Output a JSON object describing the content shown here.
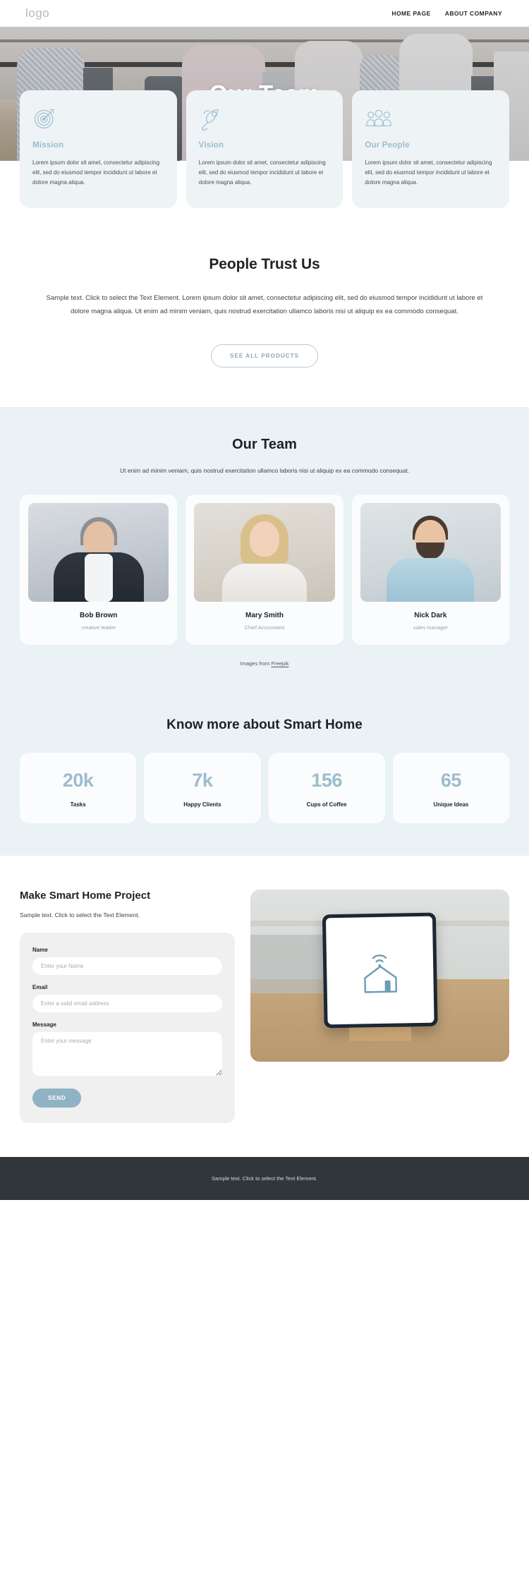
{
  "header": {
    "logo": "logo",
    "nav": [
      {
        "label": "HOME PAGE"
      },
      {
        "label": "ABOUT COMPANY"
      }
    ]
  },
  "hero": {
    "title": "Our Team"
  },
  "features": [
    {
      "icon": "target-icon",
      "title": "Mission",
      "text": "Lorem ipsum dolor sit amet, consectetur adipiscing elit, sed do eiusmod tempor incididunt ut labore et dolore magna aliqua."
    },
    {
      "icon": "rocket-icon",
      "title": "Vision",
      "text": "Lorem ipsum dolor sit amet, consectetur adipiscing elit, sed do eiusmod tempor incididunt ut labore et dolore magna aliqua."
    },
    {
      "icon": "people-group-icon",
      "title": "Our People",
      "text": "Lorem ipsum dolor sit amet, consectetur adipiscing elit, sed do eiusmod tempor incididunt ut labore et dolore magna aliqua."
    }
  ],
  "trust": {
    "title": "People Trust Us",
    "text": "Sample text. Click to select the Text Element. Lorem ipsum dolor sit amet, consectetur adipiscing elit, sed do eiusmod tempor incididunt ut labore et dolore magna aliqua. Ut enim ad minim veniam, quis nostrud exercitation ullamco laboris nisi ut aliquip ex ea commodo consequat.",
    "button_label": "SEE ALL PRODUCTS"
  },
  "team": {
    "title": "Our Team",
    "subtitle": "Ut enim ad minim veniam, quis nostrud exercitation ullamco laboris nisi ut aliquip ex ea commodo consequat.",
    "members": [
      {
        "name": "Bob Brown",
        "role": "creative leader"
      },
      {
        "name": "Mary Smith",
        "role": "Chief Accountant"
      },
      {
        "name": "Nick Dark",
        "role": "sales manager"
      }
    ],
    "credit_prefix": "Images from ",
    "credit_link": "Freepik"
  },
  "stats": {
    "title": "Know more about Smart Home",
    "items": [
      {
        "value": "20k",
        "label": "Tasks"
      },
      {
        "value": "7k",
        "label": "Happy Clients"
      },
      {
        "value": "156",
        "label": "Cups of Coffee"
      },
      {
        "value": "65",
        "label": "Unique Ideas"
      }
    ]
  },
  "contact": {
    "title": "Make Smart Home Project",
    "subtitle": "Sample text. Click to select the Text Element.",
    "fields": {
      "name_label": "Name",
      "name_placeholder": "Enter your Name",
      "email_label": "Email",
      "email_placeholder": "Enter a valid email address",
      "message_label": "Message",
      "message_placeholder": "Enter your message"
    },
    "send_label": "SEND"
  },
  "footer": {
    "text": "Sample text. Click to select the Text Element."
  },
  "colors": {
    "accent": "#9bbdcd",
    "accent_button": "#8fb3c4",
    "section_bg": "#eaf2f6",
    "card_bg": "#eef3f6",
    "footer_bg": "#31363a"
  }
}
